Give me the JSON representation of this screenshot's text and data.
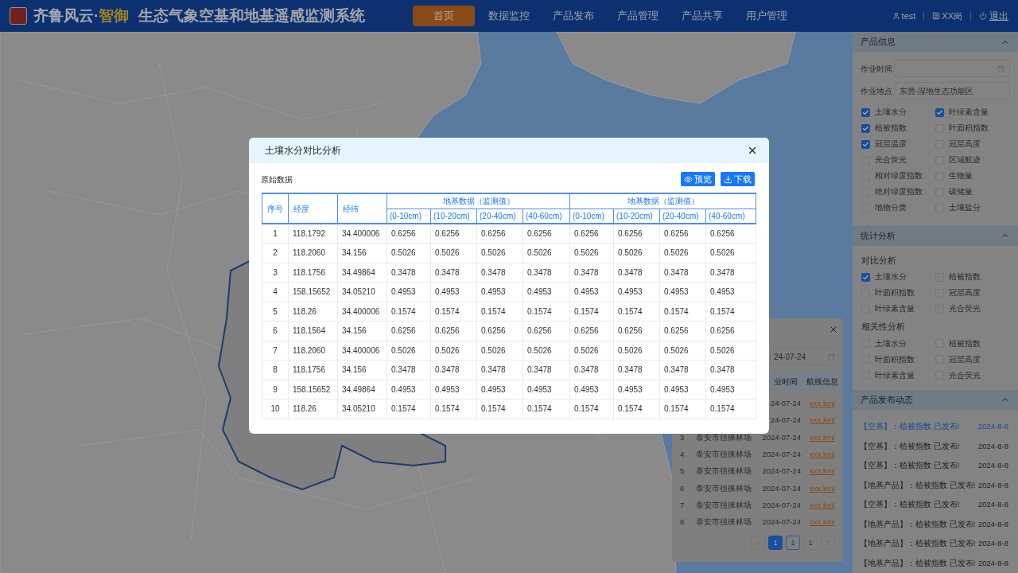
{
  "header": {
    "brand": "齐鲁风云·",
    "brand_highlight": "智御",
    "title": "生态气象空基和地基遥感监测系统",
    "nav": [
      {
        "label": "首页",
        "selected": true
      },
      {
        "label": "数据监控",
        "selected": false
      },
      {
        "label": "产品发布",
        "selected": false
      },
      {
        "label": "产品管理",
        "selected": false
      },
      {
        "label": "产品共享",
        "selected": false
      },
      {
        "label": "用户管理",
        "selected": false
      }
    ],
    "user": "test",
    "role": "XX岗",
    "logout": "退出"
  },
  "modal": {
    "title": "土壤水分对比分析",
    "section": "原始数据",
    "buttons": [
      {
        "kind": "preview",
        "label": "预览"
      },
      {
        "kind": "download",
        "label": "下载"
      }
    ],
    "table": {
      "columns": [
        "序号",
        "经度",
        "经纬"
      ],
      "groups": [
        {
          "title": "地基数据（监测值）",
          "subcolumns": [
            "(0-10cm)",
            "(10-20cm)",
            "(20-40cm)",
            "(40-60cm)"
          ]
        },
        {
          "title": "地基数据（监测值）",
          "subcolumns": [
            "(0-10cm)",
            "(10-20cm)",
            "(20-40cm)",
            "(40-60cm)"
          ]
        }
      ],
      "rows": [
        [
          "1",
          "118.1792",
          "34.400006",
          "0.6256",
          "0.6256",
          "0.6256",
          "0.6256",
          "0.6256",
          "0.6256",
          "0.6256",
          "0.6256"
        ],
        [
          "2",
          "118.2060",
          "34.156",
          "0.5026",
          "0.5026",
          "0.5026",
          "0.5026",
          "0.5026",
          "0.5026",
          "0.5026",
          "0.5026"
        ],
        [
          "3",
          "118.1756",
          "34.49864",
          "0.3478",
          "0.3478",
          "0.3478",
          "0.3478",
          "0.3478",
          "0.3478",
          "0.3478",
          "0.3478"
        ],
        [
          "4",
          "158.15652",
          "34.05210",
          "0.4953",
          "0.4953",
          "0.4953",
          "0.4953",
          "0.4953",
          "0.4953",
          "0.4953",
          "0.4953"
        ],
        [
          "5",
          "118.26",
          "34.400006",
          "0.1574",
          "0.1574",
          "0.1574",
          "0.1574",
          "0.1574",
          "0.1574",
          "0.1574",
          "0.1574"
        ],
        [
          "6",
          "118.1564",
          "34.156",
          "0.6256",
          "0.6256",
          "0.6256",
          "0.6256",
          "0.6256",
          "0.6256",
          "0.6256",
          "0.6256"
        ],
        [
          "7",
          "118.2060",
          "34.400006",
          "0.5026",
          "0.5026",
          "0.5026",
          "0.5026",
          "0.5026",
          "0.5026",
          "0.5026",
          "0.5026"
        ],
        [
          "8",
          "118.1756",
          "34.156",
          "0.3478",
          "0.3478",
          "0.3478",
          "0.3478",
          "0.3478",
          "0.3478",
          "0.3478",
          "0.3478"
        ],
        [
          "9",
          "158.15652",
          "34.49864",
          "0.4953",
          "0.4953",
          "0.4953",
          "0.4953",
          "0.4953",
          "0.4953",
          "0.4953",
          "0.4953"
        ],
        [
          "10",
          "118.26",
          "34.05210",
          "0.1574",
          "0.1574",
          "0.1574",
          "0.1574",
          "0.1574",
          "0.1574",
          "0.1574",
          "0.1574"
        ]
      ]
    }
  },
  "flight_panel": {
    "date_value": "24-07-24",
    "columns": [
      "业时间",
      "航线信息"
    ],
    "rows": [
      {
        "index": "",
        "place": "",
        "date": "24-07-24",
        "file": "xxx.kml"
      },
      {
        "index": "",
        "place": "",
        "date": "24-07-24",
        "file": "xxx.kml"
      },
      {
        "index": "3",
        "place": "泰安市徂徕林场",
        "date": "2024-07-24",
        "file": "xxx.kml"
      },
      {
        "index": "4",
        "place": "泰安市徂徕林场",
        "date": "2024-07-24",
        "file": "xxx.kml"
      },
      {
        "index": "5",
        "place": "泰安市徂徕林场",
        "date": "2024-07-24",
        "file": "xxx.kml"
      },
      {
        "index": "6",
        "place": "泰安市徂徕林场",
        "date": "2024-07-24",
        "file": "xxx.kml"
      },
      {
        "index": "7",
        "place": "泰安市徂徕林场",
        "date": "2024-07-24",
        "file": "xxx.kml"
      },
      {
        "index": "8",
        "place": "泰安市徂徕林场",
        "date": "2024-07-24",
        "file": "xxx.kml"
      }
    ],
    "pages": [
      {
        "label": "1",
        "selected": true,
        "focused": false
      },
      {
        "label": "1",
        "selected": false,
        "focused": true
      },
      {
        "label": "1",
        "selected": false,
        "focused": false
      }
    ]
  },
  "sidebar": {
    "product_info": {
      "title": "产品信息",
      "expanded": true,
      "fields": [
        {
          "label": "作业时间"
        },
        {
          "label": "作业地点",
          "value": "东营-湿地生态功能区"
        }
      ],
      "options": [
        {
          "label": "土壤水分",
          "checked": true
        },
        {
          "label": "叶绿素含量",
          "checked": true
        },
        {
          "label": "植被指数",
          "checked": true
        },
        {
          "label": "叶面积指数",
          "checked": false
        },
        {
          "label": "冠层温度",
          "checked": true
        },
        {
          "label": "冠层高度",
          "checked": false
        },
        {
          "label": "光合荧光",
          "checked": false
        },
        {
          "label": "区域航迹",
          "checked": false
        },
        {
          "label": "相对绿度指数",
          "checked": false
        },
        {
          "label": "生物量",
          "checked": false
        },
        {
          "label": "绝对绿度指数",
          "checked": false
        },
        {
          "label": "碳储量",
          "checked": false
        },
        {
          "label": "地物分类",
          "checked": false
        },
        {
          "label": "土壤盐分",
          "checked": false
        }
      ]
    },
    "statistics": {
      "title": "统计分析",
      "expanded": true,
      "groups": [
        {
          "title": "对比分析",
          "options": [
            {
              "label": "土壤水分",
              "checked": true
            },
            {
              "label": "植被指数",
              "checked": false
            },
            {
              "label": "叶面积指数",
              "checked": false
            },
            {
              "label": "冠层高度",
              "checked": false
            },
            {
              "label": "叶绿素含量",
              "checked": false
            },
            {
              "label": "光合荧光",
              "checked": false
            }
          ]
        },
        {
          "title": "相关性分析",
          "options": [
            {
              "label": "土壤水分",
              "checked": false
            },
            {
              "label": "植被指数",
              "checked": false
            },
            {
              "label": "叶面积指数",
              "checked": false
            },
            {
              "label": "冠层高度",
              "checked": false
            },
            {
              "label": "叶绿素含量",
              "checked": false
            },
            {
              "label": "光合荧光",
              "checked": false
            }
          ]
        }
      ]
    },
    "news": {
      "title": "产品发布动态",
      "expanded": true,
      "items": [
        {
          "text": "【空基】：植被指数 已发布!",
          "date": "2024-8-8",
          "selected": true
        },
        {
          "text": "【空基】：植被指数 已发布!",
          "date": "2024-8-8",
          "selected": false
        },
        {
          "text": "【空基】：植被指数 已发布!",
          "date": "2024-8-8",
          "selected": false
        },
        {
          "text": "【地基产品】：植被指数 已发布!",
          "date": "2024-8-8",
          "selected": false
        },
        {
          "text": "【空基】：植被指数 已发布!",
          "date": "2024-8-8",
          "selected": false
        },
        {
          "text": "【地基产品】：植被指数 已发布!",
          "date": "2024-8-8",
          "selected": false
        },
        {
          "text": "【地基产品】：植被指数 已发布!",
          "date": "2024-8-8",
          "selected": false
        },
        {
          "text": "【地基产品】：植被指数 已发布!",
          "date": "2024-8-8",
          "selected": false
        }
      ]
    }
  }
}
